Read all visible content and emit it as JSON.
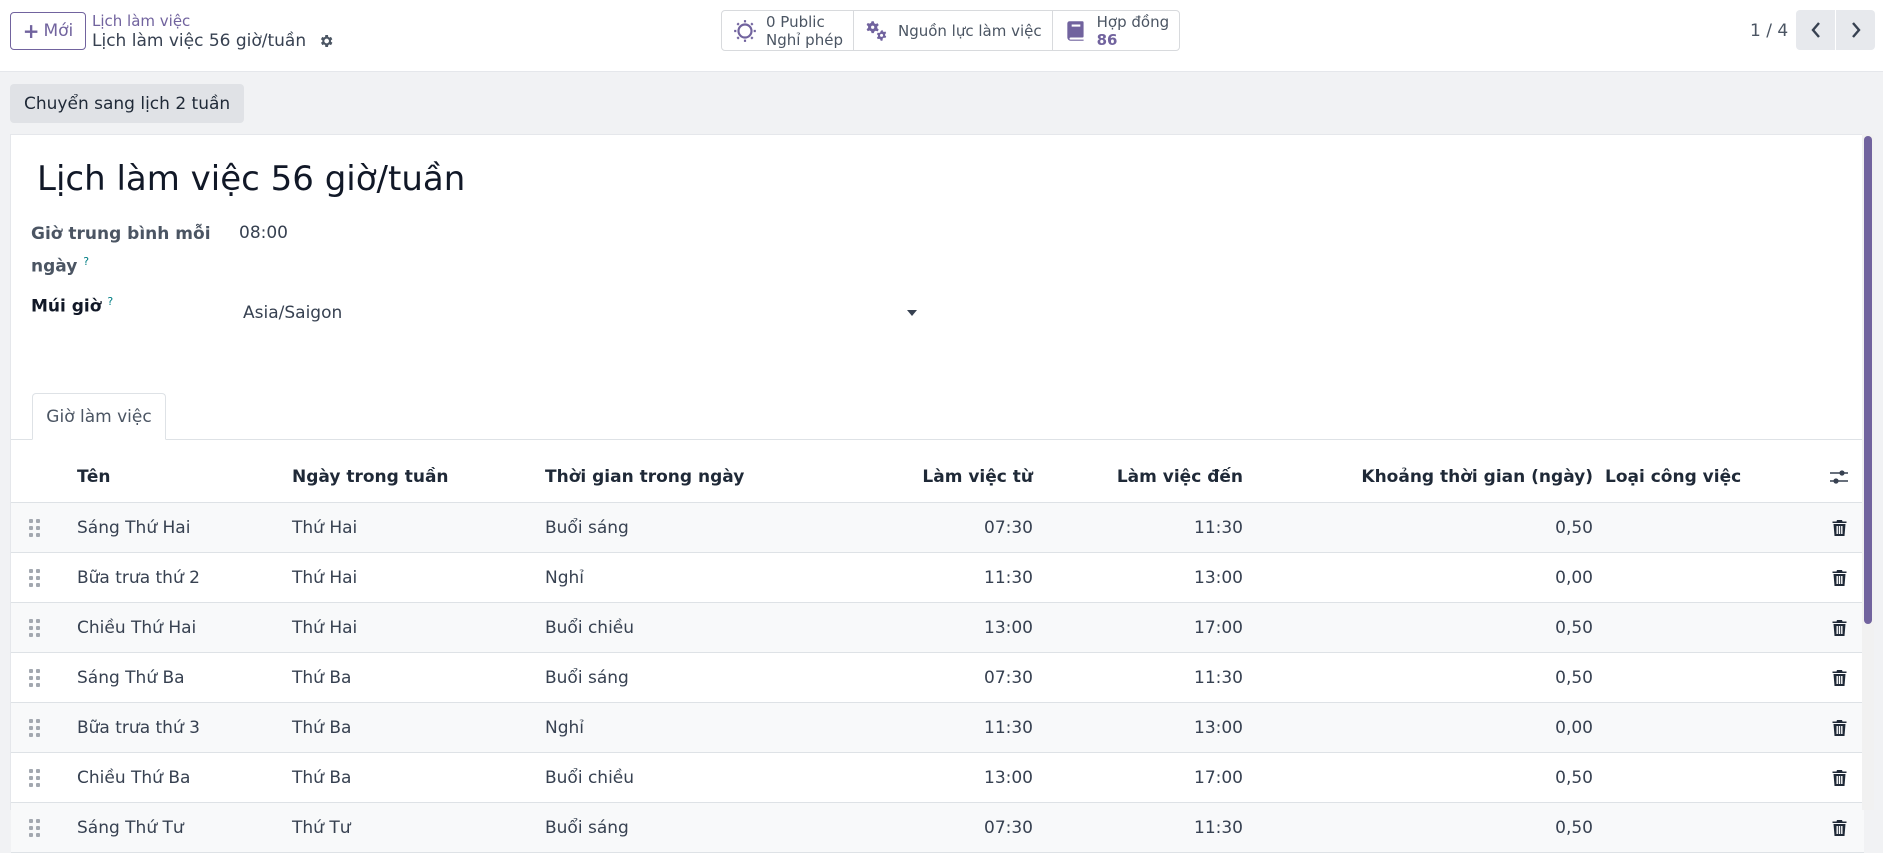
{
  "control_panel": {
    "new_label": "Mới",
    "breadcrumb_parent": "Lịch làm việc",
    "breadcrumb_current": "Lịch làm việc 56 giờ/tuần",
    "smart_buttons": [
      {
        "line1": "0 Public",
        "line2": "Nghỉ phép",
        "icon": "sun-icon"
      },
      {
        "line1": "Nguồn lực làm việc",
        "icon": "gears-icon"
      },
      {
        "line1": "Hợp đồng",
        "line2": "86",
        "icon": "book-icon"
      }
    ],
    "pager": "1 / 4"
  },
  "actions": {
    "switch_label": "Chuyển sang lịch 2 tuần"
  },
  "form": {
    "title": "Lịch làm việc 56 giờ/tuần",
    "avg_hours_label": "Giờ trung bình mỗi ngày",
    "avg_hours_value": "08:00",
    "timezone_label": "Múi giờ",
    "timezone_value": "Asia/Saigon",
    "help_mark": "?",
    "tab_label": "Giờ làm việc"
  },
  "table": {
    "headers": {
      "name": "Tên",
      "day": "Ngày trong tuần",
      "period": "Thời gian trong ngày",
      "from": "Làm việc từ",
      "to": "Làm việc đến",
      "duration": "Khoảng thời gian (ngày)",
      "type": "Loại công việc"
    },
    "rows": [
      {
        "name": "Sáng Thứ Hai",
        "day": "Thứ Hai",
        "period": "Buổi sáng",
        "from": "07:30",
        "to": "11:30",
        "duration": "0,50"
      },
      {
        "name": "Bữa trưa thứ 2",
        "day": "Thứ Hai",
        "period": "Nghỉ",
        "from": "11:30",
        "to": "13:00",
        "duration": "0,00"
      },
      {
        "name": "Chiều Thứ Hai",
        "day": "Thứ Hai",
        "period": "Buổi chiều",
        "from": "13:00",
        "to": "17:00",
        "duration": "0,50"
      },
      {
        "name": "Sáng Thứ Ba",
        "day": "Thứ Ba",
        "period": "Buổi sáng",
        "from": "07:30",
        "to": "11:30",
        "duration": "0,50"
      },
      {
        "name": "Bữa trưa thứ 3",
        "day": "Thứ Ba",
        "period": "Nghỉ",
        "from": "11:30",
        "to": "13:00",
        "duration": "0,00"
      },
      {
        "name": "Chiều Thứ Ba",
        "day": "Thứ Ba",
        "period": "Buổi chiều",
        "from": "13:00",
        "to": "17:00",
        "duration": "0,50"
      },
      {
        "name": "Sáng Thứ Tư",
        "day": "Thứ Tư",
        "period": "Buổi sáng",
        "from": "07:30",
        "to": "11:30",
        "duration": "0,50"
      }
    ]
  },
  "colors": {
    "accent": "#71639e",
    "help": "#017e84"
  }
}
